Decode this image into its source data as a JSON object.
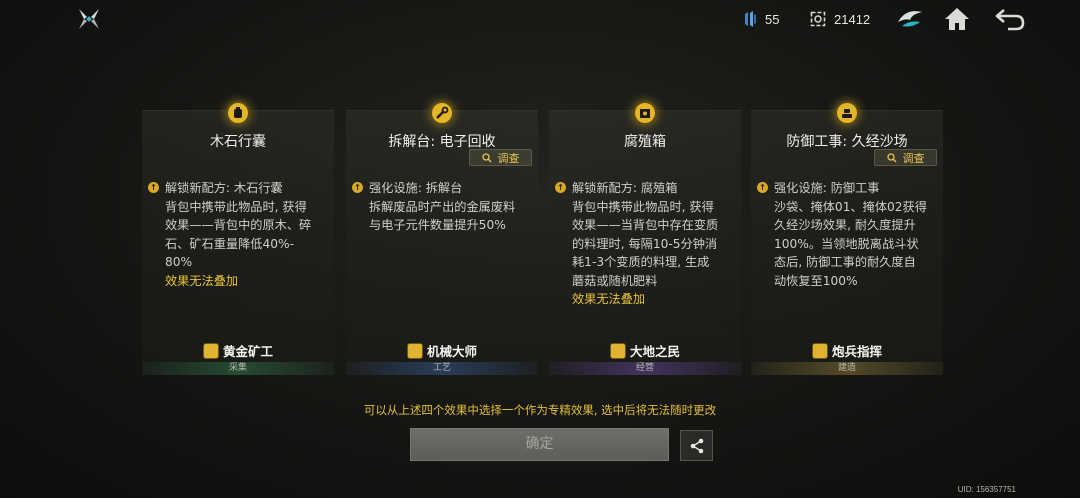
{
  "header": {
    "logo_icon": "crossed-blades-logo-icon",
    "resource1": {
      "icon": "blue-crystal-icon",
      "value": "55"
    },
    "resource2": {
      "icon": "gear-frame-currency-icon",
      "value": "21412"
    },
    "buttons": [
      "emblem-icon",
      "home-icon",
      "back-arrow-icon"
    ]
  },
  "cards": [
    {
      "title": "木石行囊",
      "has_investigate": false,
      "lines": [
        {
          "text": "解锁新配方: 木石行囊",
          "bullet": true,
          "yellow": false
        },
        {
          "text": "背包中携带此物品时, 获得",
          "bullet": false,
          "yellow": false
        },
        {
          "text": "效果——背包中的原木、碎",
          "bullet": false,
          "yellow": false
        },
        {
          "text": "石、矿石重量降低40%-",
          "bullet": false,
          "yellow": false
        },
        {
          "text": "80%",
          "bullet": false,
          "yellow": false
        },
        {
          "text": "效果无法叠加",
          "bullet": false,
          "yellow": true
        }
      ],
      "skill": "黄金矿工",
      "category": "采集"
    },
    {
      "title": "拆解台: 电子回收",
      "has_investigate": true,
      "lines": [
        {
          "text": "强化设施: 拆解台",
          "bullet": true,
          "yellow": false
        },
        {
          "text": "拆解废品时产出的金属废料",
          "bullet": false,
          "yellow": false
        },
        {
          "text": "与电子元件数量提升50%",
          "bullet": false,
          "yellow": false
        }
      ],
      "skill": "机械大师",
      "category": "工艺"
    },
    {
      "title": "腐殖箱",
      "has_investigate": false,
      "lines": [
        {
          "text": "解锁新配方: 腐殖箱",
          "bullet": true,
          "yellow": false
        },
        {
          "text": "背包中携带此物品时, 获得",
          "bullet": false,
          "yellow": false
        },
        {
          "text": "效果——当背包中存在变质",
          "bullet": false,
          "yellow": false
        },
        {
          "text": "的料理时, 每隔10-5分钟消",
          "bullet": false,
          "yellow": false
        },
        {
          "text": "耗1-3个变质的料理, 生成",
          "bullet": false,
          "yellow": false
        },
        {
          "text": "蘑菇或随机肥料",
          "bullet": false,
          "yellow": false
        },
        {
          "text": "效果无法叠加",
          "bullet": false,
          "yellow": true
        }
      ],
      "skill": "大地之民",
      "category": "经营"
    },
    {
      "title": "防御工事: 久经沙场",
      "has_investigate": true,
      "lines": [
        {
          "text": "强化设施: 防御工事",
          "bullet": true,
          "yellow": false
        },
        {
          "text": "沙袋、掩体01、掩体02获得",
          "bullet": false,
          "yellow": false
        },
        {
          "text": "久经沙场效果, 耐久度提升",
          "bullet": false,
          "yellow": false
        },
        {
          "text": "100%。当领地脱离战斗状",
          "bullet": false,
          "yellow": false
        },
        {
          "text": "态后, 防御工事的耐久度自",
          "bullet": false,
          "yellow": false
        },
        {
          "text": "动恢复至100%",
          "bullet": false,
          "yellow": false
        }
      ],
      "skill": "炮兵指挥",
      "category": "建造"
    }
  ],
  "investigate_label": "调查",
  "notice": "可以从上述四个效果中选择一个作为专精效果, 选中后将无法随时更改",
  "confirm_label": "确定",
  "uid": "UID: 156357751"
}
